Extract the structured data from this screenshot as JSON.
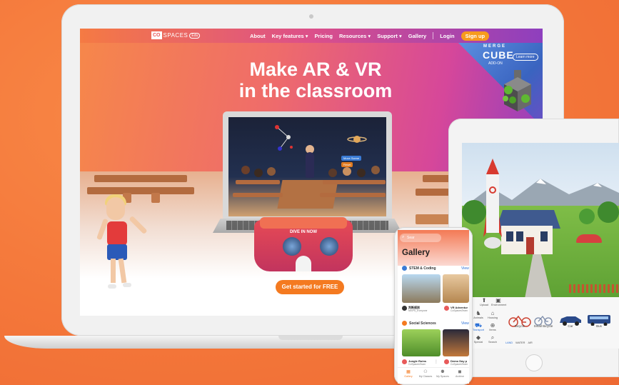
{
  "nav": {
    "logo_mark": "CO",
    "logo_text": "SPACES",
    "logo_badge": "Edu",
    "links": [
      "About",
      "Key features ▾",
      "Pricing",
      "Resources ▾",
      "Support ▾",
      "Gallery"
    ],
    "login": "Login",
    "signup": "Sign up"
  },
  "hero": {
    "headline_line1": "Make AR & VR",
    "headline_line2": "in the classroom",
    "vr_label": "DIVE IN NOW",
    "cta": "Get started for FREE"
  },
  "promo": {
    "title": "CUBE",
    "brand": "MERGE",
    "sub": "ADD-ON",
    "button": "Learn more"
  },
  "scene_bubbles": [
    "Move Scene",
    "Reset"
  ],
  "phone": {
    "search_placeholder": "Sear",
    "title": "Gallery",
    "sections": [
      {
        "label": "STEM & Coding",
        "view": "View"
      },
      {
        "label": "Social Sciences",
        "view": "View"
      }
    ],
    "cards": [
      {
        "title": "判断规则",
        "subtitle": "NISPS_Everyone"
      },
      {
        "title": "VR Adventur",
        "subtitle": "CoSpacesTeam"
      },
      {
        "title": "Jungle Ruins",
        "subtitle": "CoSpacesTeam"
      },
      {
        "title": "Demo Day p",
        "subtitle": "CoSpacesTeam"
      }
    ],
    "tabs": [
      {
        "icon": "▦",
        "label": "Gallery"
      },
      {
        "icon": "⚇",
        "label": "My Classes"
      },
      {
        "icon": "⚉",
        "label": "My Spaces"
      },
      {
        "icon": "◼",
        "label": "Archive"
      }
    ]
  },
  "tablet": {
    "categories": [
      {
        "icon": "⬆",
        "label": "Upload"
      },
      {
        "icon": "▣",
        "label": "Environment"
      },
      {
        "icon": "♞",
        "label": "Animals"
      },
      {
        "icon": "⌂",
        "label": "Housing"
      },
      {
        "icon": "⛟",
        "label": "Transport"
      },
      {
        "icon": "⊕",
        "label": "Items"
      },
      {
        "icon": "◆",
        "label": "Special"
      },
      {
        "icon": "⌕",
        "label": "Search"
      }
    ],
    "items": [
      "Bicycle",
      "Small Bicycle",
      "Car",
      "Bus"
    ],
    "filters": [
      "LAND",
      "WATER",
      "AIR"
    ]
  },
  "colors": {
    "background": "#f47a3a",
    "cta": "#f47a20",
    "signup": "#f79b1d",
    "accent_blue": "#2a6fd6"
  }
}
